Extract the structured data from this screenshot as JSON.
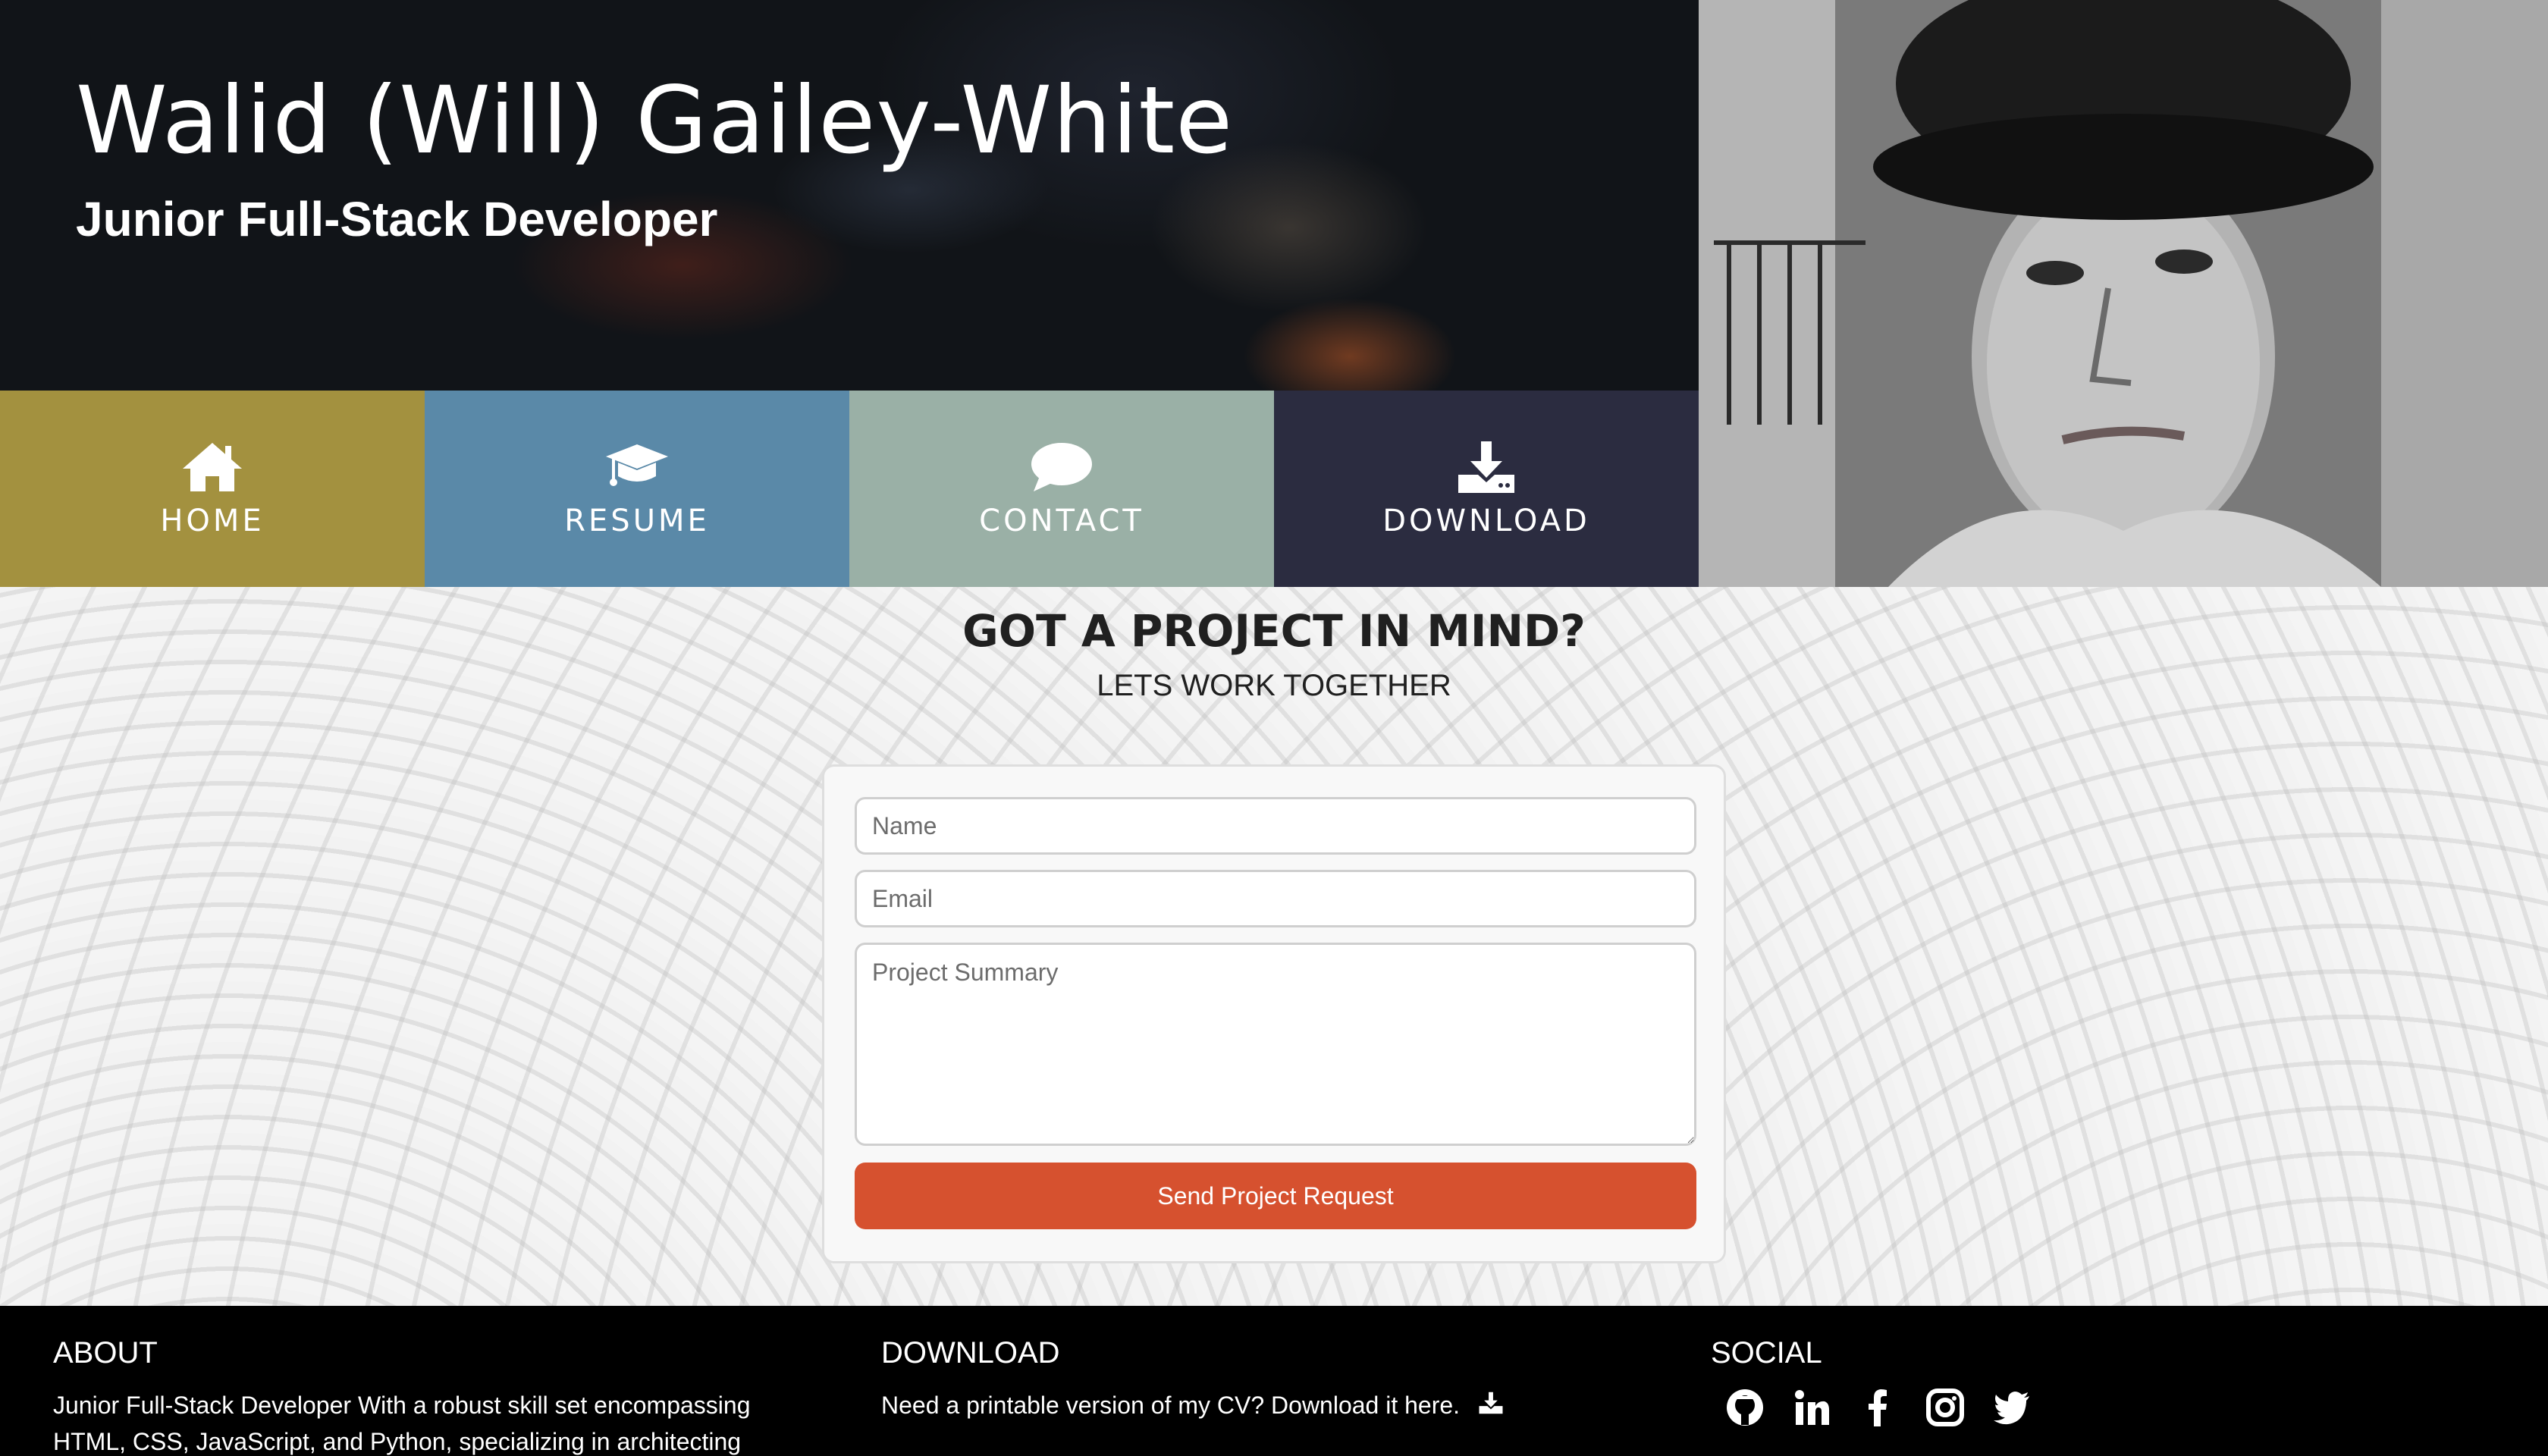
{
  "hero": {
    "name": "Walid (Will) Gailey-White",
    "role": "Junior Full-Stack Developer"
  },
  "nav": [
    {
      "label": "HOME",
      "icon": "home-icon",
      "color": "#a3913f"
    },
    {
      "label": "RESUME",
      "icon": "graduation-cap-icon",
      "color": "#5a89a8"
    },
    {
      "label": "CONTACT",
      "icon": "speech-bubble-icon",
      "color": "#9ab0a6"
    },
    {
      "label": "DOWNLOAD",
      "icon": "download-icon",
      "color": "#2b2c40"
    }
  ],
  "contact": {
    "heading": "GOT A PROJECT IN MIND?",
    "subheading": "LETS WORK TOGETHER",
    "name_placeholder": "Name",
    "email_placeholder": "Email",
    "summary_placeholder": "Project Summary",
    "submit_label": "Send Project Request",
    "accent_color": "#d6512f"
  },
  "footer": {
    "about_title": "ABOUT",
    "about_text": "Junior Full-Stack Developer With a robust skill set encompassing HTML, CSS, JavaScript, and Python, specializing in architecting",
    "download_title": "DOWNLOAD",
    "download_text": "Need a printable version of my CV? Download it here.",
    "social_title": "SOCIAL",
    "social_icons": [
      "github-icon",
      "linkedin-icon",
      "facebook-icon",
      "instagram-icon",
      "twitter-icon"
    ]
  }
}
